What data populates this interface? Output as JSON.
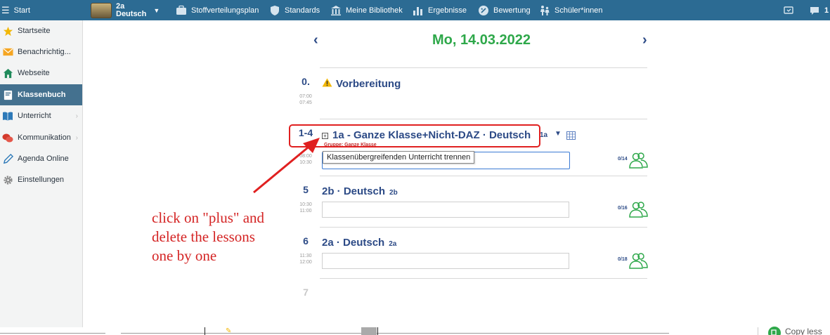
{
  "topbar": {
    "start_label": "Start",
    "class_code": "2a",
    "class_subject": "Deutsch",
    "nav": [
      {
        "label": "Stoffverteilungsplan",
        "icon": "briefcase-icon"
      },
      {
        "label": "Standards",
        "icon": "shield-icon"
      },
      {
        "label": "Meine Bibliothek",
        "icon": "library-icon"
      },
      {
        "label": "Ergebnisse",
        "icon": "bar-chart-icon"
      },
      {
        "label": "Bewertung",
        "icon": "grading-icon"
      },
      {
        "label": "Schüler*innen",
        "icon": "students-icon"
      }
    ],
    "chat_count": "1"
  },
  "sidebar": {
    "items": [
      {
        "label": "Startseite",
        "icon": "star-icon"
      },
      {
        "label": "Benachrichtig...",
        "icon": "mail-icon"
      },
      {
        "label": "Webseite",
        "icon": "home-icon"
      },
      {
        "label": "Klassenbuch",
        "icon": "book-icon",
        "active": true
      },
      {
        "label": "Unterricht",
        "icon": "open-book-icon",
        "has_submenu": true
      },
      {
        "label": "Kommunikation",
        "icon": "chat-icon",
        "has_submenu": true
      },
      {
        "label": "Agenda Online",
        "icon": "pen-icon"
      },
      {
        "label": "Einstellungen",
        "icon": "gear-icon"
      }
    ]
  },
  "day": {
    "date": "Mo, 14.03.2022",
    "prev_arrow": "‹",
    "next_arrow": "›"
  },
  "periods": [
    {
      "num": "0.",
      "start": "07:00",
      "end": "07:45",
      "title": "Vorbereitung"
    },
    {
      "num": "1-4",
      "start": "08:00",
      "end": "10:30",
      "title": "1a - Ganze Klasse+Nicht-DAZ · Deutsch",
      "class_tag": "1a",
      "group": "Gruppe: Ganze Klasse",
      "tooltip": "Klassenübergreifenden Unterricht trennen",
      "count": "0/14"
    },
    {
      "num": "5",
      "start": "10:30",
      "end": "11:00",
      "title": "2b · Deutsch",
      "class_tag": "2b",
      "count": "0/16"
    },
    {
      "num": "6",
      "start": "11:30",
      "end": "12:00",
      "title": "2a · Deutsch",
      "class_tag": "2a",
      "count": "0/18"
    },
    {
      "num": "7"
    }
  ],
  "annotation": {
    "text_lines": [
      "click on \"plus\" and",
      "delete the lessons",
      "one by one"
    ]
  },
  "bottom": {
    "partial_label": "Copy less"
  },
  "colors": {
    "topbar": "#2c6b93",
    "active_sidebar": "#44718f",
    "date_green": "#2ea84a",
    "lesson_blue": "#2c4a86",
    "annotation_red": "#d42424"
  }
}
